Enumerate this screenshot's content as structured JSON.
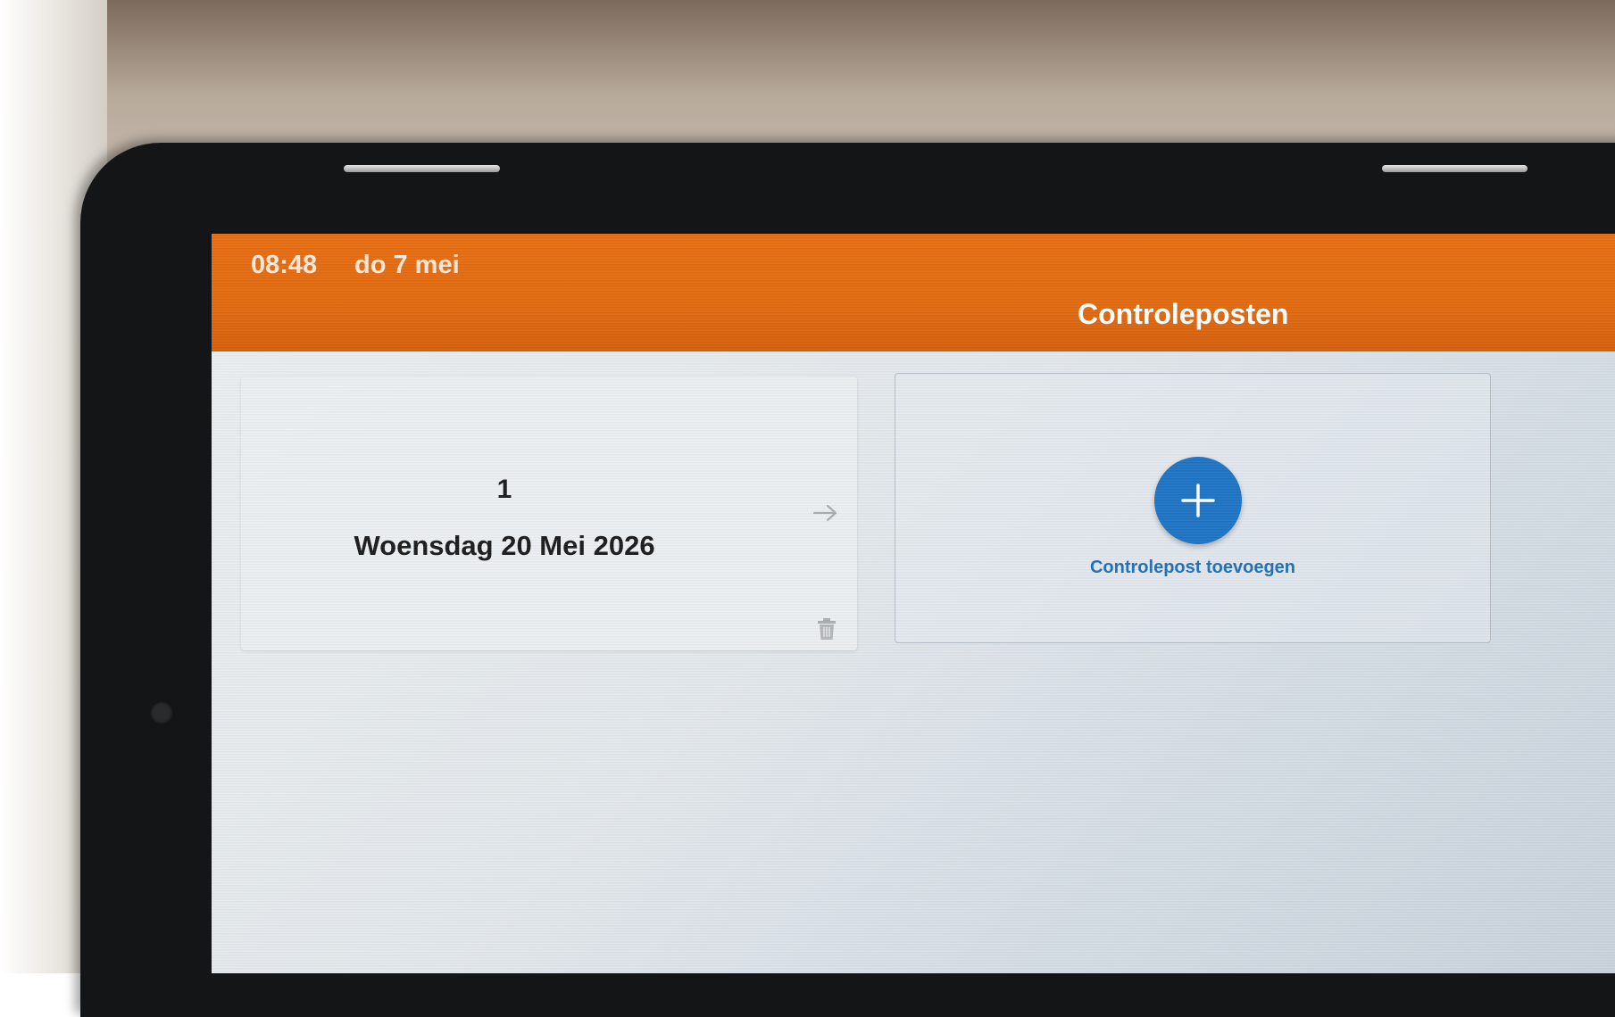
{
  "status_bar": {
    "time": "08:48",
    "date": "do 7 mei"
  },
  "header": {
    "title": "Controleposten"
  },
  "checkpoints": [
    {
      "number": "1",
      "date": "Woensdag 20 Mei 2026",
      "open_icon": "arrow-right-icon",
      "delete_icon": "trash-icon"
    }
  ],
  "add_card": {
    "label": "Controlepost toevoegen",
    "icon": "plus-icon"
  },
  "colors": {
    "header": "#e26a0f",
    "accent": "#1e74c4"
  }
}
